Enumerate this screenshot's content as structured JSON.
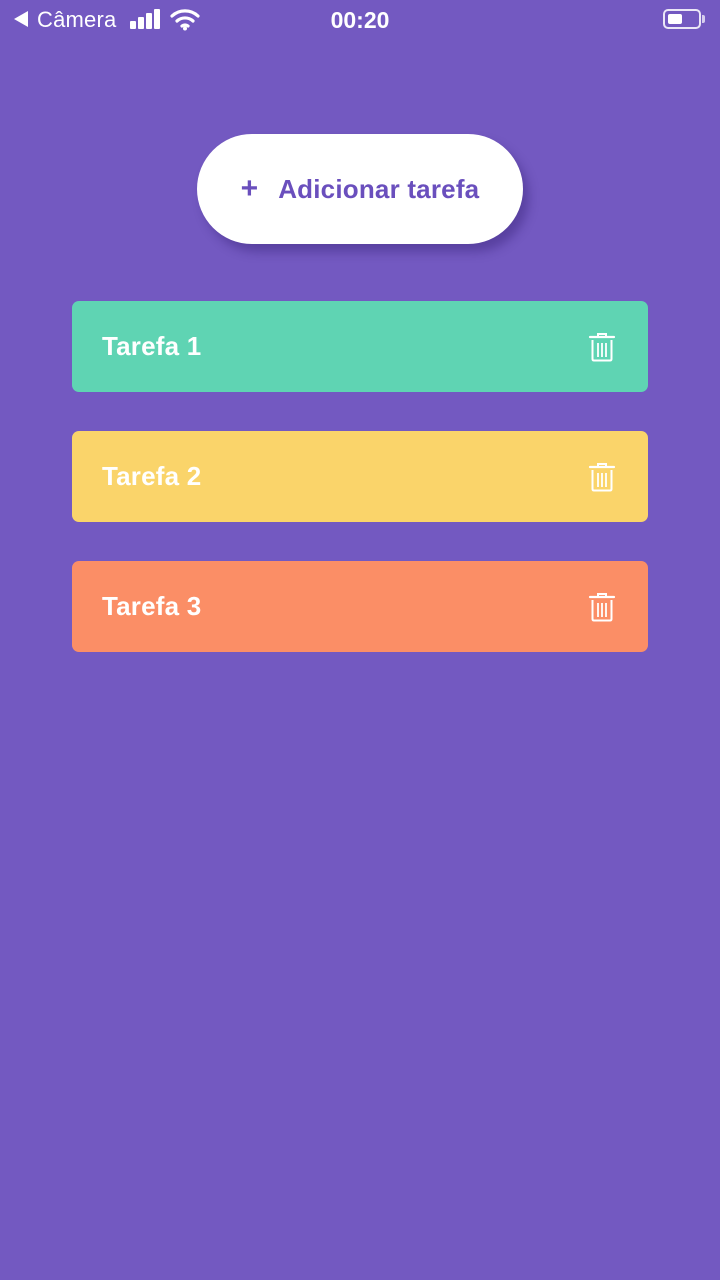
{
  "status_bar": {
    "back_label": "Câmera",
    "time": "00:20",
    "battery_level": 0.45
  },
  "add_button": {
    "icon": "plus-icon",
    "plus_symbol": "+",
    "label": "Adicionar tarefa"
  },
  "tasks": [
    {
      "title": "Tarefa 1",
      "color": "#5fd4b3",
      "action_icon": "trash-icon"
    },
    {
      "title": "Tarefa 2",
      "color": "#fad46a",
      "action_icon": "trash-icon"
    },
    {
      "title": "Tarefa 3",
      "color": "#fb8e66",
      "action_icon": "trash-icon"
    }
  ],
  "colors": {
    "background": "#7359c1",
    "accent": "#6a4fbd",
    "button_bg": "#ffffff"
  }
}
